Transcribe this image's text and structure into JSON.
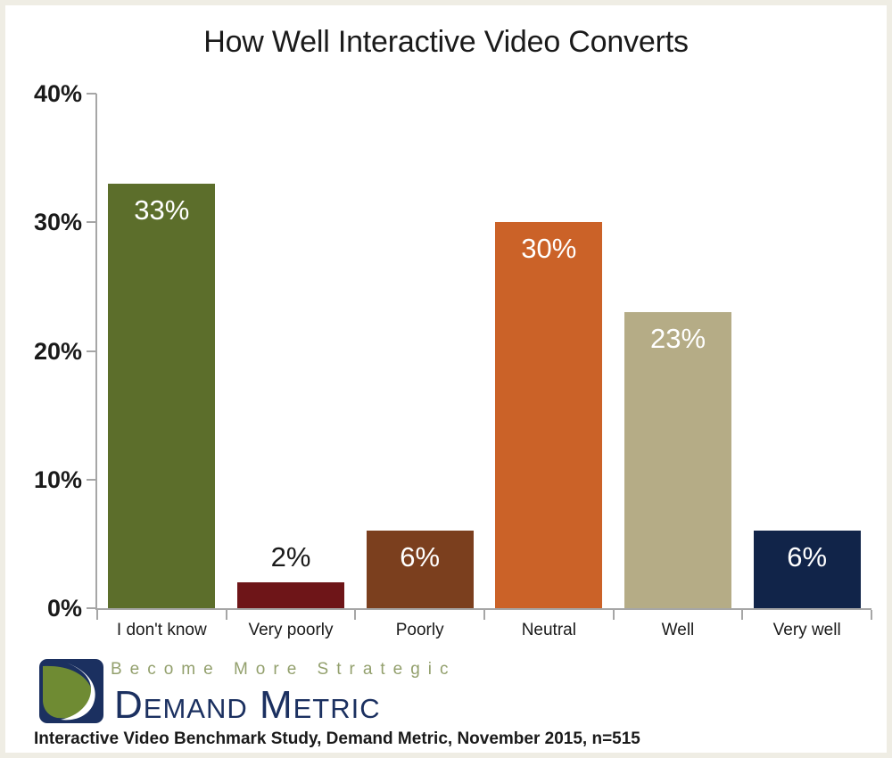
{
  "chart_data": {
    "type": "bar",
    "title": "How Well Interactive Video Converts",
    "xlabel": "",
    "ylabel": "",
    "ylim": [
      0,
      40
    ],
    "grid": false,
    "legend": "none",
    "categories": [
      "I don't know",
      "Very poorly",
      "Poorly",
      "Neutral",
      "Well",
      "Very well"
    ],
    "values": [
      33,
      2,
      6,
      30,
      23,
      6
    ],
    "value_labels": [
      "33%",
      "2%",
      "6%",
      "30%",
      "23%",
      "6%"
    ],
    "label_positions": [
      "inside",
      "outside",
      "inside",
      "inside",
      "inside",
      "inside"
    ],
    "bar_colors": [
      "#5c6e2b",
      "#6e1518",
      "#7b3f1e",
      "#cb6228",
      "#b5ac86",
      "#112449"
    ],
    "y_ticks": [
      0,
      10,
      20,
      30,
      40
    ],
    "y_tick_labels": [
      "0%",
      "10%",
      "20%",
      "30%",
      "40%"
    ]
  },
  "footer": {
    "tagline": "Become More Strategic",
    "wordmark": "Demand Metric",
    "source": "Interactive Video Benchmark Study, Demand Metric, November 2015, n=515",
    "logo_icon": "demand-metric-logo-icon"
  },
  "colors": {
    "frame": "#efede4",
    "canvas": "#ffffff",
    "axis": "#a6a6a6",
    "text": "#1a1a1a",
    "tagline_green": "#93a06d",
    "wordmark_navy": "#1b3060"
  }
}
